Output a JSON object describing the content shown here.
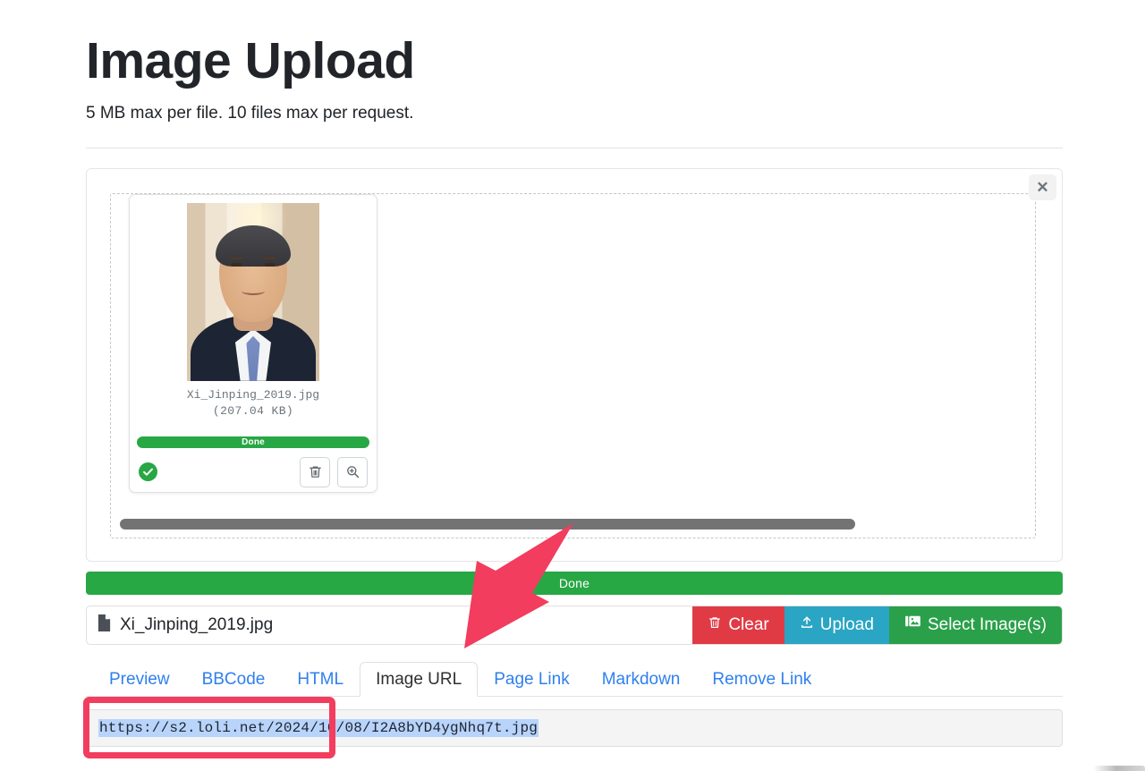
{
  "header": {
    "title": "Image Upload",
    "subtitle": "5 MB max per file. 10 files max per request."
  },
  "upload_card": {
    "close_label": "✕",
    "thumbnail": {
      "file_name": "Xi_Jinping_2019.jpg",
      "file_size": "(207.04 KB)",
      "progress_label": "Done",
      "status": "success",
      "delete_title": "Delete",
      "zoom_title": "Preview"
    }
  },
  "global_progress": {
    "label": "Done",
    "color": "#28a745"
  },
  "file_row": {
    "file_name": "Xi_Jinping_2019.jpg",
    "buttons": [
      {
        "label": "Clear",
        "icon": "trash-icon",
        "color": "#e03b45"
      },
      {
        "label": "Upload",
        "icon": "upload-icon",
        "color": "#2aa5c4"
      },
      {
        "label": "Select Image(s)",
        "icon": "images-icon",
        "color": "#2aa04a"
      }
    ]
  },
  "tabs": {
    "items": [
      {
        "label": "Preview",
        "active": false
      },
      {
        "label": "BBCode",
        "active": false
      },
      {
        "label": "HTML",
        "active": false
      },
      {
        "label": "Image URL",
        "active": true
      },
      {
        "label": "Page Link",
        "active": false
      },
      {
        "label": "Markdown",
        "active": false
      },
      {
        "label": "Remove Link",
        "active": false
      }
    ],
    "link_color": "#2f80ed"
  },
  "url_field": {
    "value": "https://s2.loli.net/2024/10/08/I2A8bYD4ygNhq7t.jpg",
    "selected": true,
    "highlight_color": "#b8d4fb",
    "annotation_color": "#f23d5e"
  },
  "annotations": {
    "arrow_color": "#f23d5e",
    "arrow_target": "url_field"
  }
}
